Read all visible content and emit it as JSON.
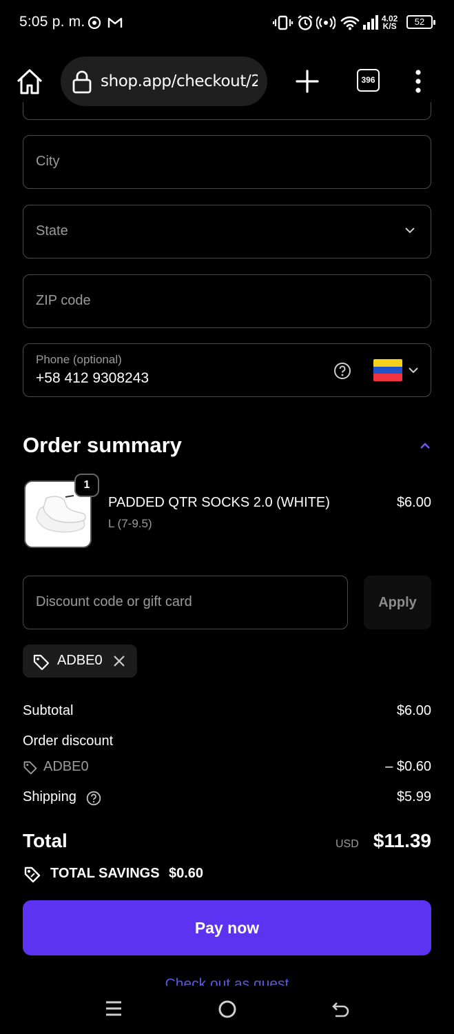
{
  "status_bar": {
    "time": "5:05 p. m.",
    "net_speed": "4.02",
    "net_unit": "K/S",
    "battery": "52"
  },
  "browser": {
    "url": "shop.app/checkout/2",
    "tab_count": "396"
  },
  "form": {
    "city_placeholder": "City",
    "state_placeholder": "State",
    "zip_placeholder": "ZIP code",
    "phone_label": "Phone (optional)",
    "phone_value": "+58 412 9308243",
    "flag_colors": [
      "#f7d117",
      "#2052c8",
      "#ef3340"
    ]
  },
  "summary": {
    "title": "Order summary",
    "item": {
      "quantity": "1",
      "name": "PADDED QTR SOCKS 2.0 (WHITE)",
      "variant": "L (7-9.5)",
      "price": "$6.00"
    },
    "discount_placeholder": "Discount code or gift card",
    "apply_label": "Apply",
    "applied_code": "ADBE0",
    "subtotal_label": "Subtotal",
    "subtotal_value": "$6.00",
    "order_discount_label": "Order discount",
    "discount_code": "ADBE0",
    "discount_value": "– $0.60",
    "shipping_label": "Shipping",
    "shipping_value": "$5.99",
    "total_label": "Total",
    "currency": "USD",
    "total_value": "$11.39",
    "savings_label": "TOTAL SAVINGS",
    "savings_value": "$0.60",
    "pay_label": "Pay now",
    "guest_label": "Check out as guest"
  },
  "colors": {
    "accent": "#5b33f0",
    "link": "#5b56e6"
  },
  "icons": [
    "home-icon",
    "lock-icon",
    "plus-icon",
    "tabs-icon",
    "more-vert-icon",
    "chevron-down-icon",
    "help-circle-icon",
    "chevron-up-icon",
    "tag-icon",
    "close-icon",
    "menu-icon",
    "circle-icon",
    "back-icon"
  ]
}
